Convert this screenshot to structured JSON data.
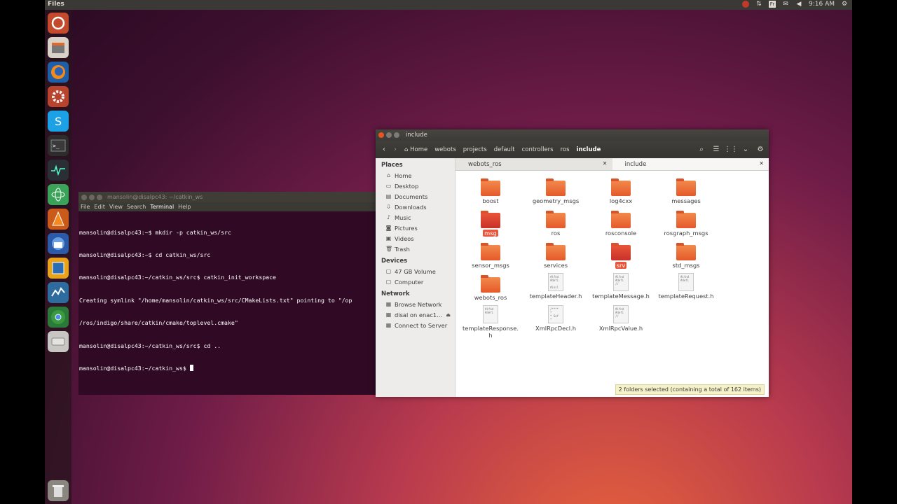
{
  "topbar": {
    "app_title": "Files",
    "time": "9:16 AM"
  },
  "launcher": {
    "items": [
      "ubuntu-dash",
      "files",
      "firefox",
      "settings",
      "skype",
      "terminal",
      "system-monitor",
      "atom",
      "vlc",
      "thunderbird",
      "virtualbox",
      "webots",
      "chrome",
      "drive",
      "trash"
    ]
  },
  "terminal": {
    "title": "mansolin@disalpc43: ~/catkin_ws",
    "menu": [
      "File",
      "Edit",
      "View",
      "Search",
      "Terminal",
      "Help"
    ],
    "lines": [
      "mansolin@disalpc43:~$ mkdir -p catkin_ws/src",
      "mansolin@disalpc43:~$ cd catkin_ws/src",
      "mansolin@disalpc43:~/catkin_ws/src$ catkin_init_workspace",
      "Creating symlink \"/home/mansolin/catkin_ws/src/CMakeLists.txt\" pointing to \"/op",
      "/ros/indigo/share/catkin/cmake/toplevel.cmake\"",
      "mansolin@disalpc43:~/catkin_ws/src$ cd ..",
      "mansolin@disalpc43:~/catkin_ws$ "
    ]
  },
  "files": {
    "title": "include",
    "breadcrumbs": [
      "Home",
      "webots",
      "projects",
      "default",
      "controllers",
      "ros",
      "include"
    ],
    "sidebar": {
      "places_title": "Places",
      "places": [
        "Home",
        "Desktop",
        "Documents",
        "Downloads",
        "Music",
        "Pictures",
        "Videos",
        "Trash"
      ],
      "devices_title": "Devices",
      "devices": [
        "47 GB Volume",
        "Computer"
      ],
      "network_title": "Network",
      "network": [
        "Browse Network",
        "disal on enac1...",
        "Connect to Server"
      ]
    },
    "tabs": [
      "webots_ros",
      "include"
    ],
    "items": [
      {
        "name": "boost",
        "type": "folder"
      },
      {
        "name": "geometry_msgs",
        "type": "folder"
      },
      {
        "name": "log4cxx",
        "type": "folder"
      },
      {
        "name": "messages",
        "type": "folder"
      },
      {
        "name": "msg",
        "type": "folder",
        "selected": true
      },
      {
        "name": "ros",
        "type": "folder"
      },
      {
        "name": "rosconsole",
        "type": "folder"
      },
      {
        "name": "rosgraph_msgs",
        "type": "folder"
      },
      {
        "name": "sensor_msgs",
        "type": "folder"
      },
      {
        "name": "services",
        "type": "folder"
      },
      {
        "name": "srv",
        "type": "folder",
        "selected": true
      },
      {
        "name": "std_msgs",
        "type": "folder"
      },
      {
        "name": "webots_ros",
        "type": "folder"
      },
      {
        "name": "templateHeader.h",
        "type": "file"
      },
      {
        "name": "templateMessage.h",
        "type": "file"
      },
      {
        "name": "templateRequest.h",
        "type": "file"
      },
      {
        "name": "templateResponse.h",
        "type": "file"
      },
      {
        "name": "XmlRpcDecl.h",
        "type": "file"
      },
      {
        "name": "XmlRpcValue.h",
        "type": "file"
      }
    ],
    "status": "2 folders selected  (containing a total of 162 items)"
  }
}
